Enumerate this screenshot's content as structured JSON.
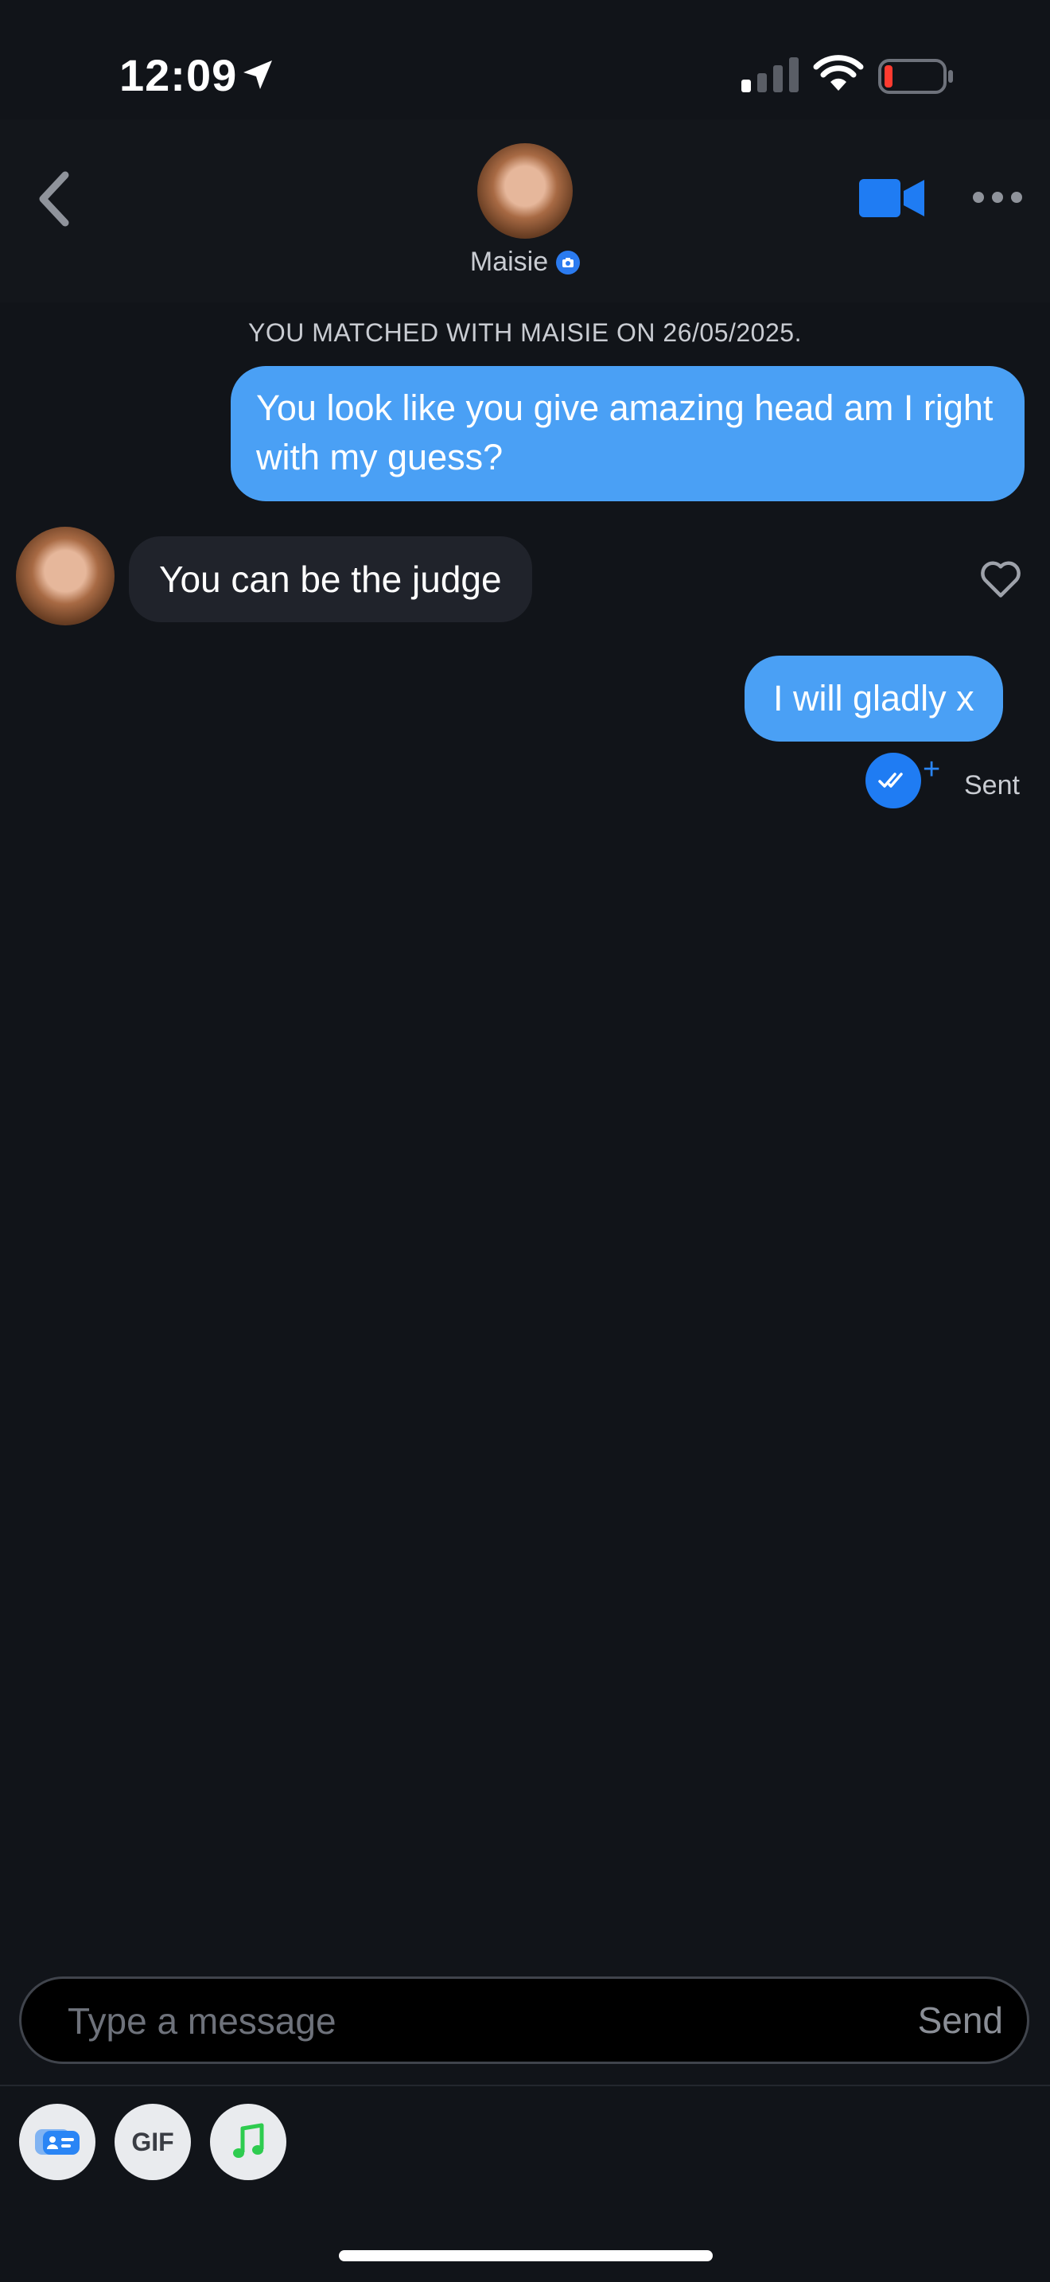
{
  "status_bar": {
    "time": "12:09",
    "icons": [
      "location-arrow-icon",
      "cellular-signal-icon",
      "wifi-icon",
      "battery-low-icon"
    ]
  },
  "header": {
    "name": "Maisie",
    "icons": [
      "back-chevron-icon",
      "verified-badge-icon",
      "video-call-icon",
      "more-options-icon"
    ]
  },
  "conversation": {
    "match_banner": "YOU MATCHED WITH MAISIE ON 26/05/2025.",
    "messages": [
      {
        "direction": "outgoing",
        "text": "You look like you give amazing head am I right with my guess?"
      },
      {
        "direction": "incoming",
        "text": "You can be the judge"
      },
      {
        "direction": "outgoing",
        "text": "I will gladly x"
      }
    ],
    "last_status": "Sent"
  },
  "composer": {
    "placeholder": "Type a message",
    "send_label": "Send",
    "gif_label": "GIF",
    "tools": [
      "profile-card-icon",
      "gif-icon",
      "music-note-icon"
    ]
  },
  "colors": {
    "background": "#111419",
    "outgoing_bubble": "#4aa0f5",
    "incoming_bubble": "#20232b",
    "accent": "#1f7cf3",
    "music_green": "#2ecc4f",
    "battery_red": "#ff3b30"
  }
}
